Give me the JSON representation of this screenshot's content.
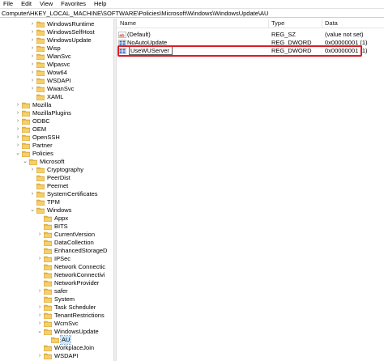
{
  "menu": [
    "File",
    "Edit",
    "View",
    "Favorites",
    "Help"
  ],
  "address": "Computer\\HKEY_LOCAL_MACHINE\\SOFTWARE\\Policies\\Microsoft\\Windows\\WindowsUpdate\\AU",
  "colors": {
    "folder": "#e8b94a",
    "folder_dark": "#c99a2e",
    "selection": "#cce8ff",
    "highlight": "#d81e27"
  },
  "tree": [
    {
      "label": "WindowsRuntime",
      "depth": 5,
      "expander": "›"
    },
    {
      "label": "WindowsSelfHost",
      "depth": 5,
      "expander": "›"
    },
    {
      "label": "WindowsUpdate",
      "depth": 5,
      "expander": "›"
    },
    {
      "label": "Wisp",
      "depth": 5,
      "expander": "›"
    },
    {
      "label": "WlanSvc",
      "depth": 5,
      "expander": "›"
    },
    {
      "label": "Wlpasvc",
      "depth": 5,
      "expander": "›"
    },
    {
      "label": "Wow64",
      "depth": 5,
      "expander": "›"
    },
    {
      "label": "WSDAPI",
      "depth": 5,
      "expander": "›"
    },
    {
      "label": "WwanSvc",
      "depth": 5,
      "expander": "›"
    },
    {
      "label": "XAML",
      "depth": 5,
      "expander": ""
    },
    {
      "label": "Mozilla",
      "depth": 3,
      "expander": "›"
    },
    {
      "label": "MozillaPlugins",
      "depth": 3,
      "expander": "›"
    },
    {
      "label": "ODBC",
      "depth": 3,
      "expander": "›"
    },
    {
      "label": "OEM",
      "depth": 3,
      "expander": "›"
    },
    {
      "label": "OpenSSH",
      "depth": 3,
      "expander": "›"
    },
    {
      "label": "Partner",
      "depth": 3,
      "expander": "›"
    },
    {
      "label": "Policies",
      "depth": 3,
      "expander": "⌄"
    },
    {
      "label": "Microsoft",
      "depth": 4,
      "expander": "⌄"
    },
    {
      "label": "Cryptography",
      "depth": 5,
      "expander": "›"
    },
    {
      "label": "PeerDist",
      "depth": 5,
      "expander": ""
    },
    {
      "label": "Peernet",
      "depth": 5,
      "expander": ""
    },
    {
      "label": "SystemCertificates",
      "depth": 5,
      "expander": "›"
    },
    {
      "label": "TPM",
      "depth": 5,
      "expander": ""
    },
    {
      "label": "Windows",
      "depth": 5,
      "expander": "⌄"
    },
    {
      "label": "Appx",
      "depth": 6,
      "expander": ""
    },
    {
      "label": "BITS",
      "depth": 6,
      "expander": ""
    },
    {
      "label": "CurrentVersion",
      "depth": 6,
      "expander": "›"
    },
    {
      "label": "DataCollection",
      "depth": 6,
      "expander": ""
    },
    {
      "label": "EnhancedStorageD",
      "depth": 6,
      "expander": ""
    },
    {
      "label": "IPSec",
      "depth": 6,
      "expander": "›"
    },
    {
      "label": "Network Connectic",
      "depth": 6,
      "expander": ""
    },
    {
      "label": "NetworkConnectivi",
      "depth": 6,
      "expander": ""
    },
    {
      "label": "NetworkProvider",
      "depth": 6,
      "expander": ""
    },
    {
      "label": "safer",
      "depth": 6,
      "expander": "›"
    },
    {
      "label": "System",
      "depth": 6,
      "expander": ""
    },
    {
      "label": "Task Scheduler",
      "depth": 6,
      "expander": "›"
    },
    {
      "label": "TenantRestrictions",
      "depth": 6,
      "expander": "›"
    },
    {
      "label": "WcmSvc",
      "depth": 6,
      "expander": "›"
    },
    {
      "label": "WindowsUpdate",
      "depth": 6,
      "expander": "⌄"
    },
    {
      "label": "AU",
      "depth": 7,
      "expander": "",
      "selected": true
    },
    {
      "label": "WorkplaceJoin",
      "depth": 6,
      "expander": ""
    },
    {
      "label": "WSDAPI",
      "depth": 6,
      "expander": "›"
    }
  ],
  "list": {
    "columns": [
      "Name",
      "Type",
      "Data"
    ],
    "rows": [
      {
        "name": "(Default)",
        "type": "REG_SZ",
        "data": "(value not set)",
        "icon": "string-value-icon"
      },
      {
        "name": "NoAutoUpdate",
        "type": "REG_DWORD",
        "data": "0x00000001 (1)",
        "icon": "binary-value-icon"
      },
      {
        "name": "UseWUServer",
        "type": "REG_DWORD",
        "data": "0x00000001 (1)",
        "icon": "binary-value-icon",
        "editing": true
      }
    ]
  }
}
